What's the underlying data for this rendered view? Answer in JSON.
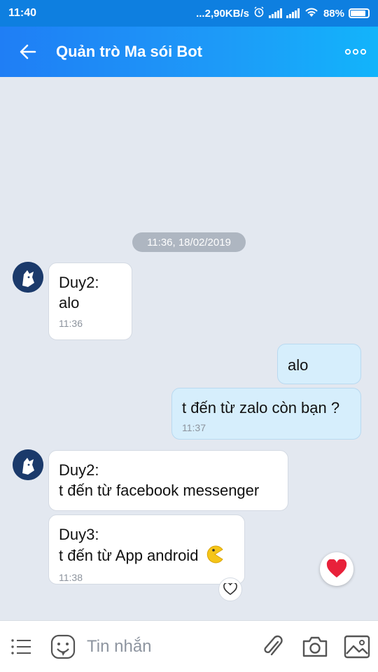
{
  "status_bar": {
    "time": "11:40",
    "network_speed": "...2,90KB/s",
    "battery": "88%"
  },
  "header": {
    "title": "Quản trò Ma sói Bot",
    "back_icon": "arrow-left-icon",
    "more_icon": "more-horizontal-icon"
  },
  "chat": {
    "date_separator": "11:36, 18/02/2019",
    "messages": [
      {
        "direction": "in",
        "sender": "Duy2:",
        "text": "alo",
        "time": "11:36"
      },
      {
        "direction": "out",
        "text": "alo",
        "time": ""
      },
      {
        "direction": "out",
        "text": "t đến từ zalo còn bạn ?",
        "time": "11:37"
      },
      {
        "direction": "in",
        "sender": "Duy2:",
        "text": "t đến từ facebook messenger",
        "time": ""
      },
      {
        "direction": "in",
        "sender": "Duy3:",
        "text": "t đến từ App android",
        "emoji": "pacman-emoji",
        "time": "11:38"
      }
    ]
  },
  "input": {
    "placeholder": "Tin nhắn",
    "icons": [
      "menu-icon",
      "sticker-icon",
      "attachment-icon",
      "camera-icon",
      "image-icon"
    ]
  },
  "colors": {
    "header_start": "#1f7ef5",
    "header_end": "#12b4fb",
    "chat_bg": "#e3e8f0",
    "outgoing_bubble": "#d6eefc",
    "heart": "#e8213a"
  }
}
